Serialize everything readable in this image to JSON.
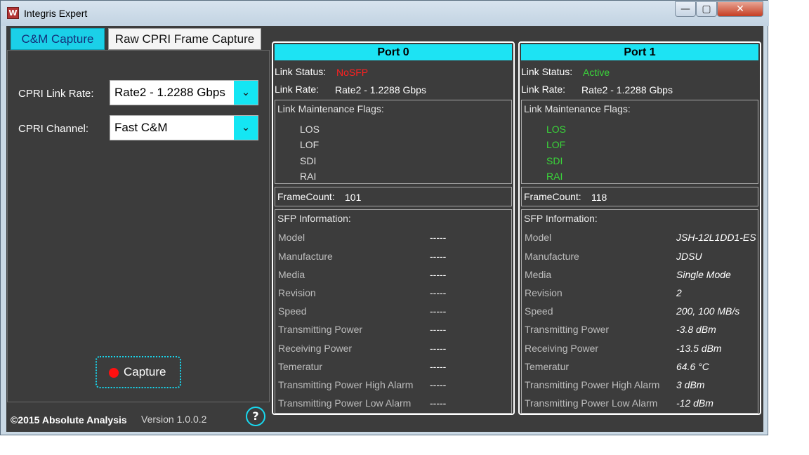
{
  "window": {
    "title": "Integris Expert",
    "app_icon": "W",
    "controls": {
      "minimize": "—",
      "maximize": "▢",
      "close": "✕"
    }
  },
  "tabs": [
    {
      "label": "C&M Capture",
      "active": true
    },
    {
      "label": "Raw CPRI Frame Capture",
      "active": false
    }
  ],
  "settings": {
    "link_rate_label": "CPRI Link Rate:",
    "link_rate_value": "Rate2 - 1.2288 Gbps",
    "channel_label": "CPRI Channel:",
    "channel_value": "Fast C&M",
    "dropdown_icon": "⌄"
  },
  "capture_button": "Capture",
  "footer": {
    "copyright": "©2015 Absolute Analysis",
    "version": "Version 1.0.0.2",
    "help": "?"
  },
  "colors": {
    "accent": "#1de3f3",
    "status_nosfp": "#ff2020",
    "status_active": "#3ad63a",
    "flag_default": "#e0e0e0"
  },
  "ports": [
    {
      "name": "Port 0",
      "link_status_label": "Link Status:",
      "link_status": "NoSFP",
      "link_rate_label": "Link Rate:",
      "link_rate": "Rate2 - 1.2288 Gbps",
      "flags_title": "Link Maintenance Flags:",
      "flags": [
        "LOS",
        "LOF",
        "SDI",
        "RAI"
      ],
      "frame_count_label": "FrameCount:",
      "frame_count": "101",
      "sfp_title": "SFP Information:",
      "sfp": [
        {
          "label": "Model",
          "value": "-----"
        },
        {
          "label": "Manufacture",
          "value": "-----"
        },
        {
          "label": "Media",
          "value": "-----"
        },
        {
          "label": "Revision",
          "value": "-----"
        },
        {
          "label": "Speed",
          "value": "-----"
        },
        {
          "label": "Transmitting Power",
          "value": "-----"
        },
        {
          "label": "Receiving Power",
          "value": "-----"
        },
        {
          "label": "Temeratur",
          "value": "-----"
        },
        {
          "label": "Transmitting Power High Alarm",
          "value": "-----"
        },
        {
          "label": "Transmitting Power Low Alarm",
          "value": "-----"
        }
      ]
    },
    {
      "name": "Port 1",
      "link_status_label": "Link Status:",
      "link_status": "Active",
      "link_rate_label": "Link Rate:",
      "link_rate": "Rate2 - 1.2288 Gbps",
      "flags_title": "Link Maintenance Flags:",
      "flags": [
        "LOS",
        "LOF",
        "SDI",
        "RAI"
      ],
      "frame_count_label": "FrameCount:",
      "frame_count": "118",
      "sfp_title": "SFP Information:",
      "sfp": [
        {
          "label": "Model",
          "value": "JSH-12L1DD1-ES"
        },
        {
          "label": "Manufacture",
          "value": "JDSU"
        },
        {
          "label": "Media",
          "value": "Single Mode"
        },
        {
          "label": "Revision",
          "value": "2"
        },
        {
          "label": "Speed",
          "value": "200, 100 MB/s"
        },
        {
          "label": "Transmitting Power",
          "value": "-3.8 dBm"
        },
        {
          "label": "Receiving Power",
          "value": "-13.5 dBm"
        },
        {
          "label": "Temeratur",
          "value": "64.6 °C"
        },
        {
          "label": "Transmitting Power High Alarm",
          "value": "3 dBm"
        },
        {
          "label": "Transmitting Power Low Alarm",
          "value": "-12 dBm"
        }
      ]
    }
  ]
}
